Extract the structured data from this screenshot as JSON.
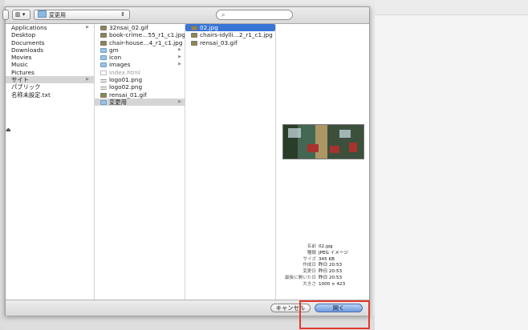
{
  "toolbar": {
    "view_toggle": "▥ ▾",
    "path_popup": "変更用",
    "path_chevron": "⇕",
    "search_icon": "⌕"
  },
  "sidebar": {
    "items": [
      {
        "label": "Applications",
        "arrow": "▶"
      },
      {
        "label": "Desktop"
      },
      {
        "label": "Documents"
      },
      {
        "label": "Downloads"
      },
      {
        "label": "Movies"
      },
      {
        "label": "Music"
      },
      {
        "label": "Pictures"
      },
      {
        "label": "サイト",
        "arrow": "▶"
      },
      {
        "label": "パブリック"
      },
      {
        "label": "名称未設定.txt"
      }
    ],
    "eject": "⏏"
  },
  "column1": {
    "items": [
      {
        "label": "32nsai_02.gif",
        "icon": "img"
      },
      {
        "label": "book-crime…55_r1_c1.jpg",
        "icon": "img"
      },
      {
        "label": "chair-house…4_r1_c1.jpg",
        "icon": "img"
      },
      {
        "label": "gm",
        "icon": "folder",
        "arrow": "▶"
      },
      {
        "label": "icon",
        "icon": "folder",
        "arrow": "▶"
      },
      {
        "label": "images",
        "icon": "folder",
        "arrow": "▶"
      },
      {
        "label": "index.html",
        "icon": "html"
      },
      {
        "label": "logo01.png",
        "icon": "line"
      },
      {
        "label": "logo02.png",
        "icon": "line"
      },
      {
        "label": "rensai_01.gif",
        "icon": "img"
      },
      {
        "label": "変更用",
        "icon": "folder",
        "arrow": "▶"
      }
    ]
  },
  "column2": {
    "items": [
      {
        "label": "02.jpg",
        "icon": "img"
      },
      {
        "label": "chairs-idylli…2_r1_c1.jpg",
        "icon": "img"
      },
      {
        "label": "rensai_03.gif",
        "icon": "img"
      }
    ]
  },
  "preview": {
    "info": [
      {
        "label": "名前",
        "value": "02.jpg"
      },
      {
        "label": "種類",
        "value": "JPEG イメージ"
      },
      {
        "label": "サイズ",
        "value": "345 KB"
      },
      {
        "label": "作成日",
        "value": "昨日 20:53"
      },
      {
        "label": "変更日",
        "value": "昨日 20:53"
      },
      {
        "label": "最後に開いた日",
        "value": "昨日 20:53"
      },
      {
        "label": "大きさ",
        "value": "1000 × 423"
      }
    ]
  },
  "buttons": {
    "cancel": "キャンセル",
    "open": "開く"
  },
  "colors": {
    "selection_blue": "#3875d7",
    "highlight_red": "#e2382f"
  }
}
